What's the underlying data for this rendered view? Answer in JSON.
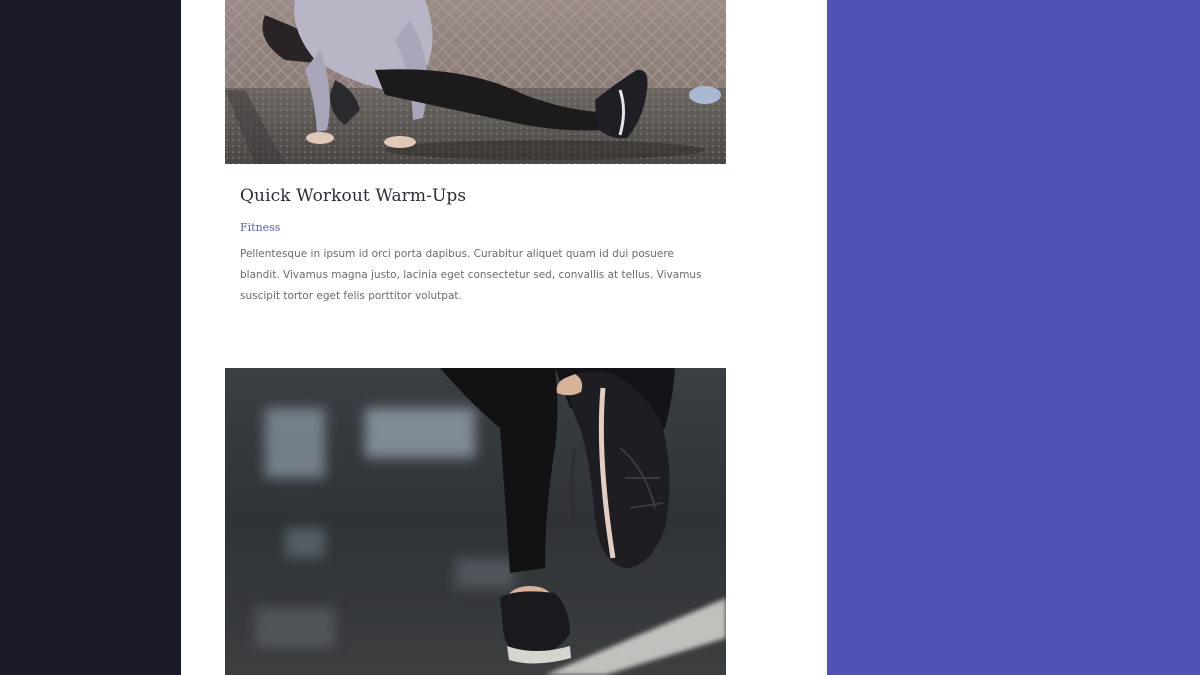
{
  "post": {
    "title": "Quick Workout Warm-Ups",
    "category": "Fitness",
    "excerpt": "Pellentesque in ipsum id orci porta dapibus. Curabitur aliquet quam id dui posuere blandit. Vivamus magna justo, lacinia eget consectetur sed, convallis at tellus. Vivamus suscipit tortor eget felis porttitor volutpat."
  },
  "colors": {
    "left_panel": "#1b1a2b",
    "content_bg": "#ffffff",
    "right_panel": "#5152b5",
    "category_link": "#5c5cc0",
    "title_text": "#2d2d36",
    "body_text": "#6b6b72"
  },
  "images": {
    "top": "woman-stretching-photo",
    "bottom": "runner-shoes-photo"
  }
}
